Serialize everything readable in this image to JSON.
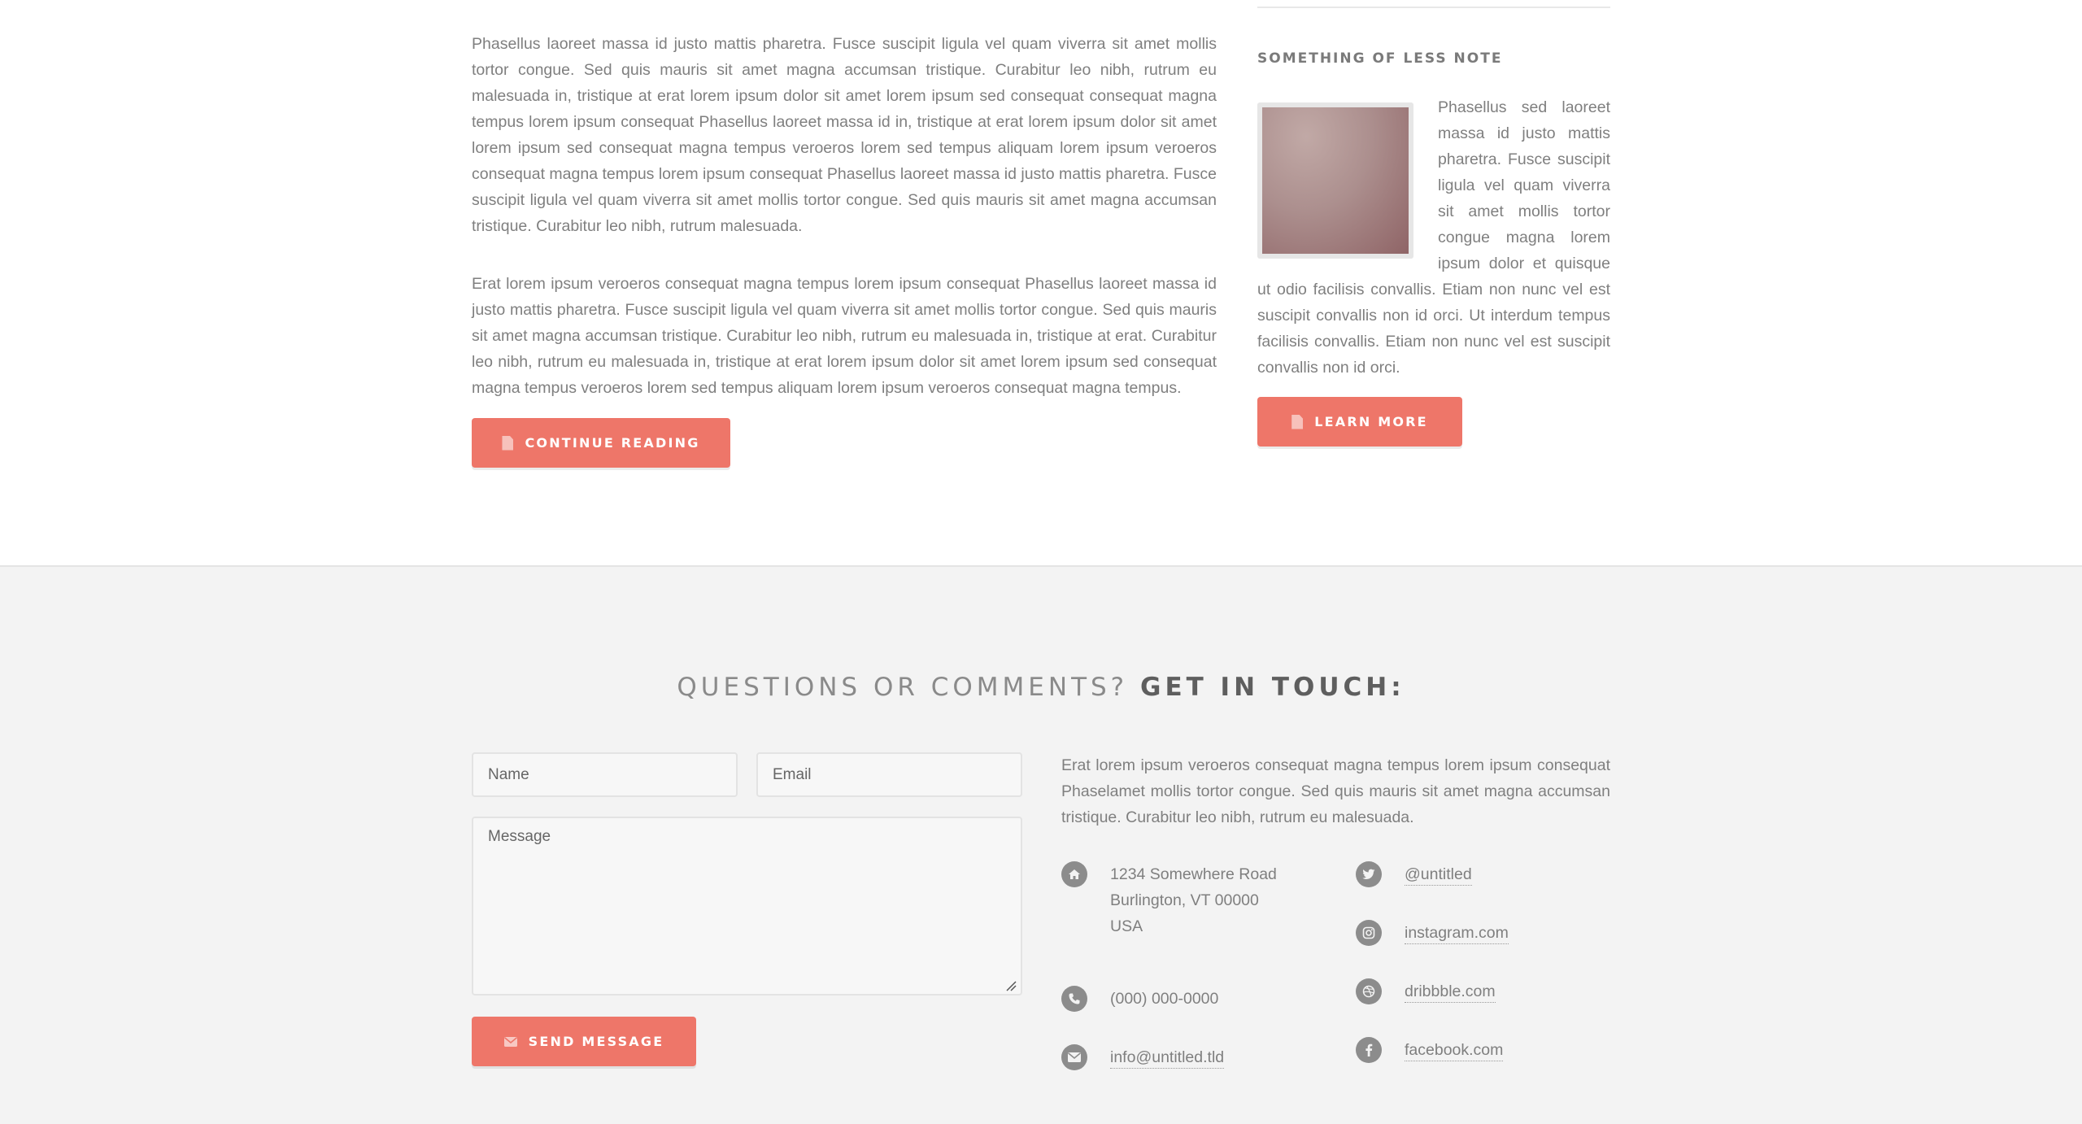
{
  "main": {
    "paragraphs": [
      "Phasellus laoreet massa id justo mattis pharetra. Fusce suscipit ligula vel quam viverra sit amet mollis tortor congue. Sed quis mauris sit amet magna accumsan tristique. Curabitur leo nibh, rutrum eu malesuada in, tristique at erat lorem ipsum dolor sit amet lorem ipsum sed consequat consequat magna tempus lorem ipsum consequat Phasellus laoreet massa id in, tristique at erat lorem ipsum dolor sit amet lorem ipsum sed consequat magna tempus veroeros lorem sed tempus aliquam lorem ipsum veroeros consequat magna tempus lorem ipsum consequat Phasellus laoreet massa id justo mattis pharetra. Fusce suscipit ligula vel quam viverra sit amet mollis tortor congue. Sed quis mauris sit amet magna accumsan tristique. Curabitur leo nibh, rutrum malesuada.",
      "Erat lorem ipsum veroeros consequat magna tempus lorem ipsum consequat Phasellus laoreet massa id justo mattis pharetra. Fusce suscipit ligula vel quam viverra sit amet mollis tortor congue. Sed quis mauris sit amet magna accumsan tristique. Curabitur leo nibh, rutrum eu malesuada in, tristique at erat. Curabitur leo nibh, rutrum eu malesuada in, tristique at erat lorem ipsum dolor sit amet lorem ipsum sed consequat magna tempus veroeros lorem sed tempus aliquam lorem ipsum veroeros consequat magna tempus."
    ],
    "continue_label": "Continue Reading"
  },
  "sidebar": {
    "title": "Something of less note",
    "body": "Phasellus sed laoreet massa id justo mattis pharetra. Fusce suscipit ligula vel quam viverra sit amet mollis tortor congue magna lorem ipsum dolor et quisque ut odio facilisis convallis. Etiam non nunc vel est suscipit convallis non id orci. Ut interdum tempus facilisis convallis. Etiam non nunc vel est suscipit convallis non id orci.",
    "learn_label": "Learn More"
  },
  "contact": {
    "heading_light": "Questions or comments?",
    "heading_bold": "Get in touch:",
    "form": {
      "name_placeholder": "Name",
      "email_placeholder": "Email",
      "message_placeholder": "Message",
      "send_label": "Send Message"
    },
    "text": "Erat lorem ipsum veroeros consequat magna tempus lorem ipsum consequat Phaselamet mollis tortor congue. Sed quis mauris sit amet magna accumsan tristique. Curabitur leo nibh, rutrum eu malesuada.",
    "address": {
      "icon": "home-icon",
      "line1": "1234 Somewhere Road",
      "line2": "Burlington, VT 00000",
      "line3": "USA"
    },
    "phone": {
      "icon": "phone-icon",
      "value": "(000) 000-0000"
    },
    "email": {
      "icon": "envelope-icon",
      "value": "info@untitled.tld"
    },
    "social": {
      "twitter": {
        "icon": "twitter-icon",
        "value": "@untitled"
      },
      "instagram": {
        "icon": "instagram-icon",
        "value": "instagram.com"
      },
      "dribbble": {
        "icon": "dribbble-icon",
        "value": "dribbble.com"
      },
      "facebook": {
        "icon": "facebook-icon",
        "value": "facebook.com"
      }
    }
  },
  "colors": {
    "accent": "#ee7669",
    "text": "#7f7f7f",
    "contact_bg": "#f3f3f3",
    "icon_bg": "#8c8c8c"
  }
}
